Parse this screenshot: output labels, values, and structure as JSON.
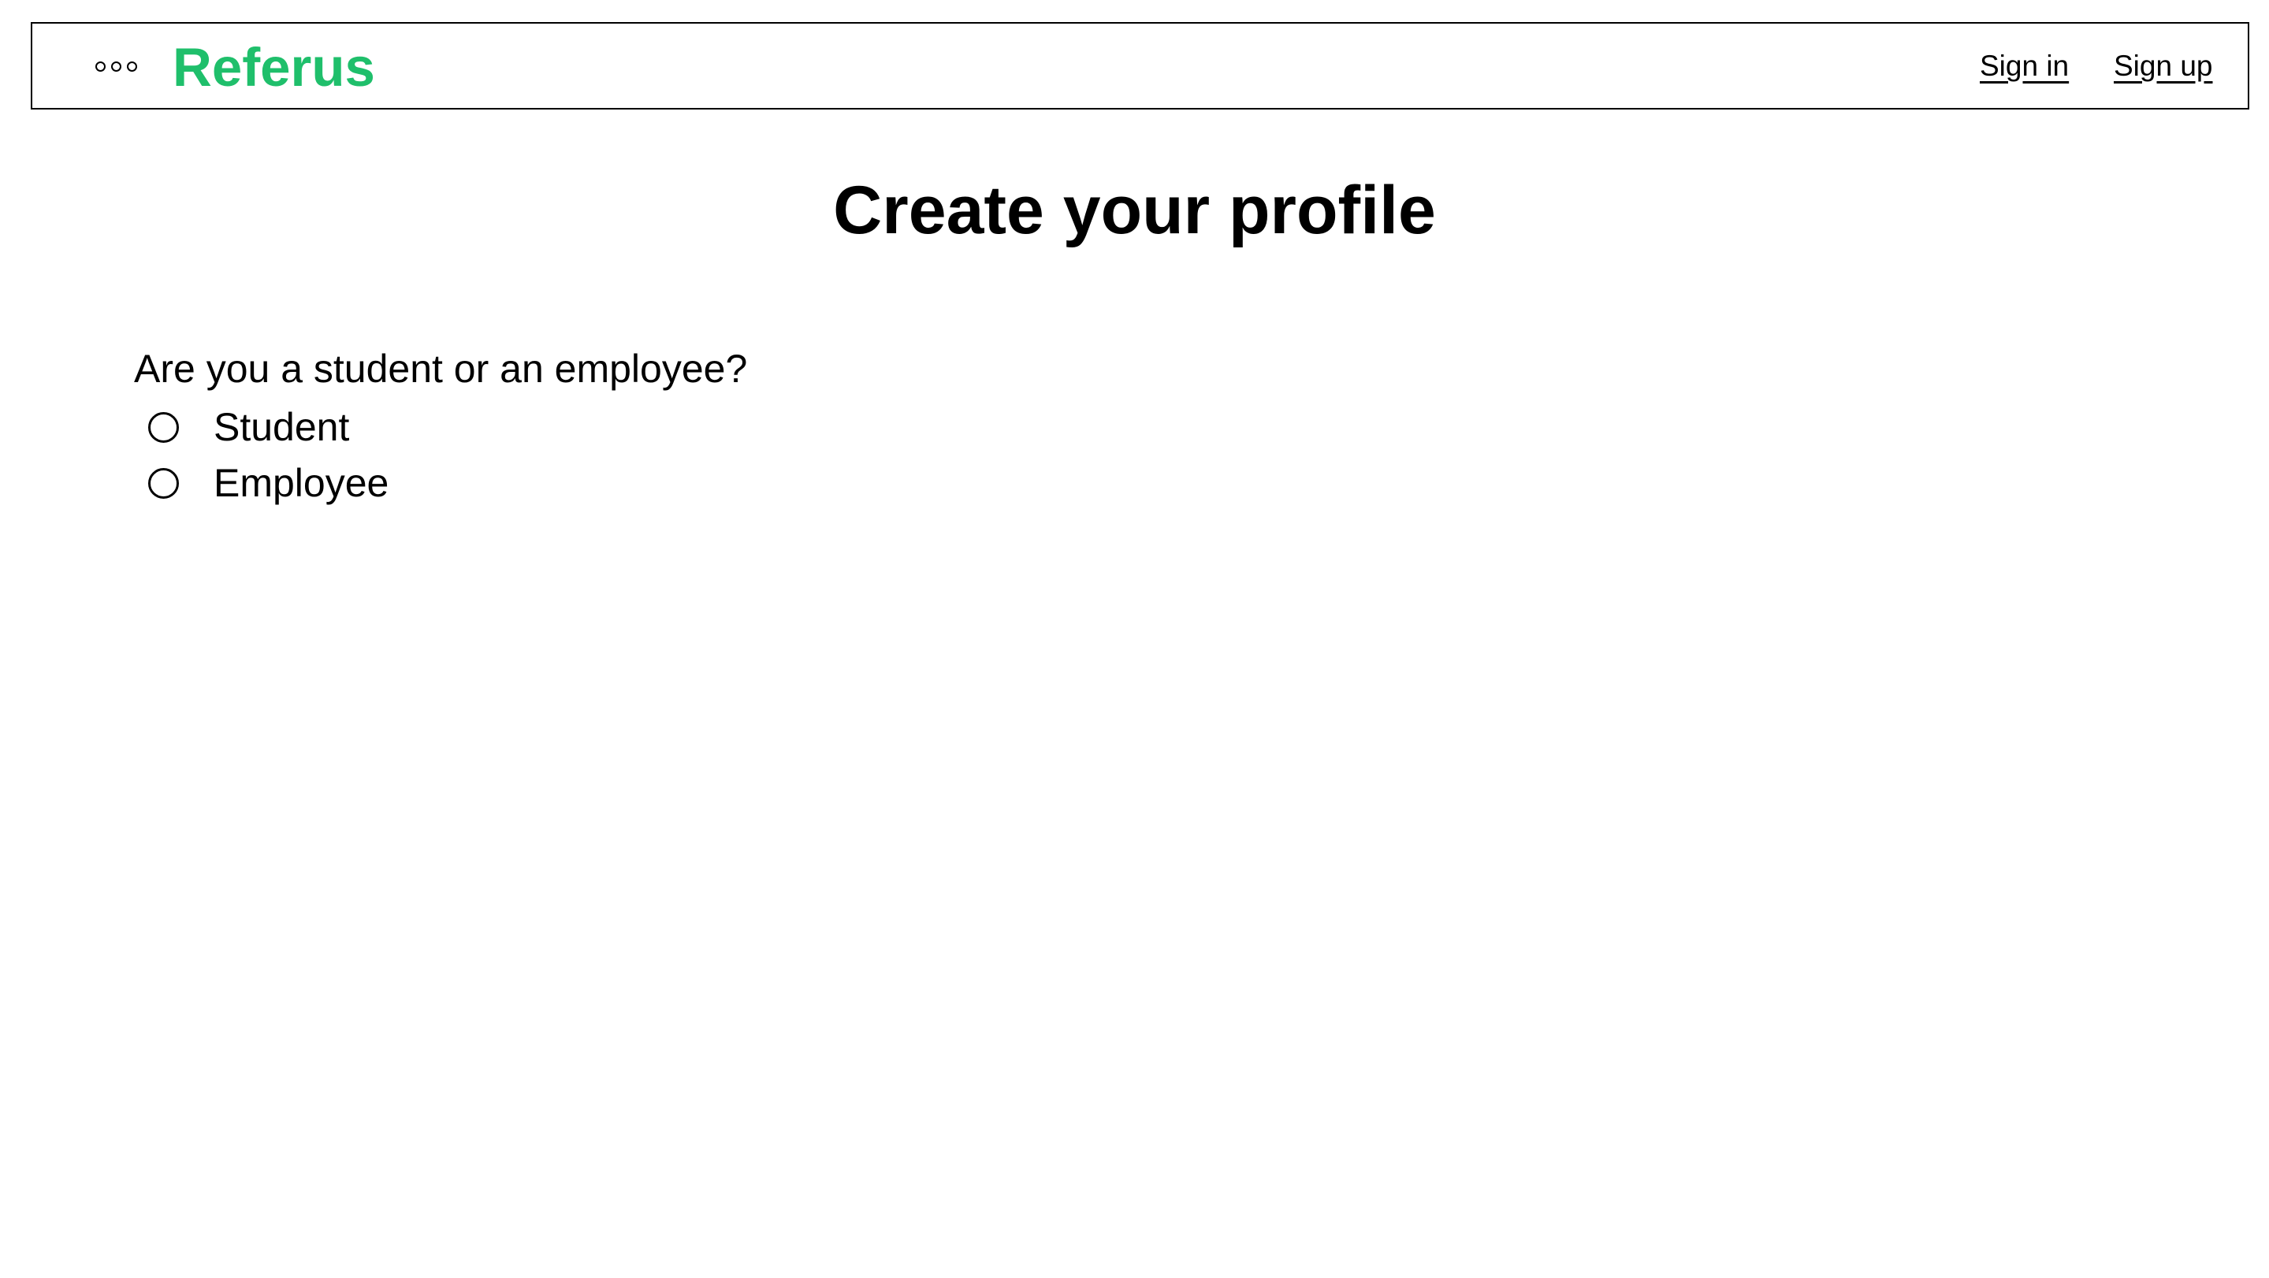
{
  "header": {
    "brand": "Referus",
    "brand_color": "#1fbf6b",
    "menu_icon": "more-dots-icon",
    "nav": {
      "sign_in": "Sign in",
      "sign_up": "Sign up"
    }
  },
  "main": {
    "title": "Create your profile",
    "question": "Are you a student or an employee?",
    "options": [
      {
        "label": "Student",
        "selected": false
      },
      {
        "label": "Employee",
        "selected": false
      }
    ]
  }
}
